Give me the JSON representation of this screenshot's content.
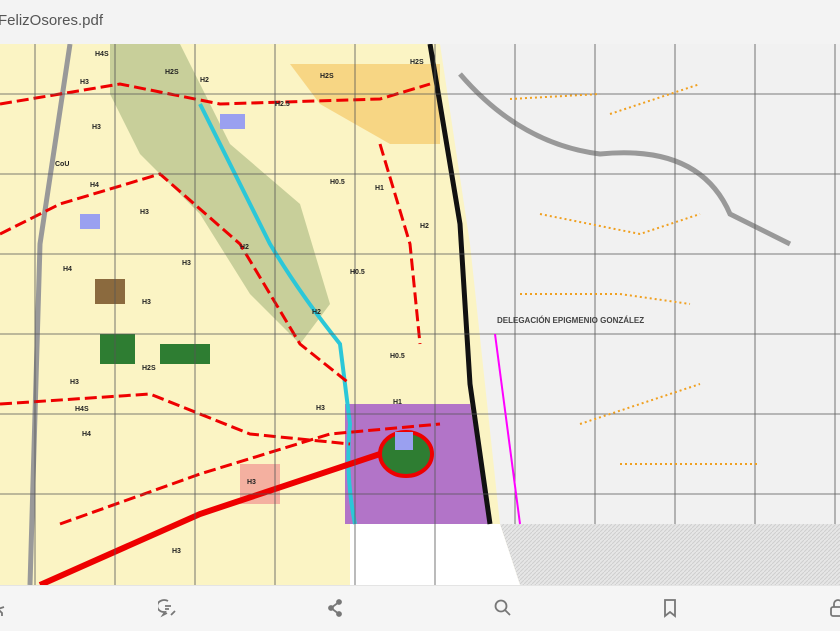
{
  "header": {
    "title": "FelizOsores.pdf"
  },
  "map": {
    "delegation_label": "DELEGACIÓN EPIGMENIO GONZÁLEZ",
    "zone_labels": [
      "H4S",
      "H3",
      "H2S",
      "H2",
      "H2.5",
      "H2S",
      "H2S",
      "H3",
      "H4",
      "CoU",
      "H3",
      "H2",
      "H1",
      "H0.5",
      "H0.5",
      "H0.5",
      "H2",
      "H4",
      "H3",
      "H3",
      "H4S",
      "H2S",
      "H3",
      "H2",
      "H1",
      "H4",
      "H3",
      "H3",
      "H3"
    ]
  },
  "toolbar": {
    "items": [
      "edit-icon",
      "comment-icon",
      "share-icon",
      "search-icon",
      "bookmark-icon",
      "lock-icon"
    ]
  }
}
